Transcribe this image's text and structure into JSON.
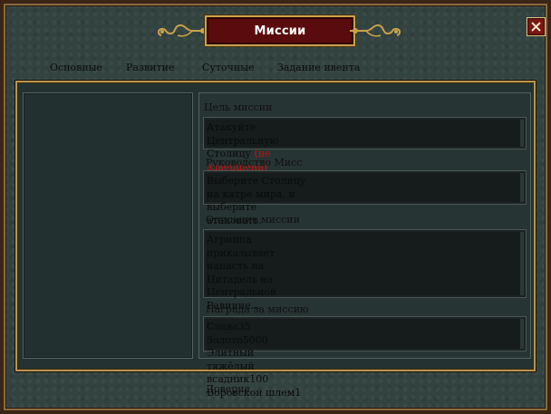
{
  "window": {
    "title": "Миссии",
    "close_label": "close"
  },
  "tabs": [
    {
      "label": "Основные"
    },
    {
      "label": "Развитие"
    },
    {
      "label": "Суточные"
    },
    {
      "label": "Задание ивента"
    }
  ],
  "mission": {
    "goal_label": "Цель миссии",
    "goal_text": "Атакуйте Центральную Столицу",
    "goal_status": "(не завершена)",
    "guide_label": "Руководство Мисс",
    "guide_text": "Выберите Столицу на катре мира, и выберите атаковать.",
    "description_label": "Описание миссии",
    "description_text": "Агриппа приказывает напасть на Цитадель на Центральной Равнине...",
    "reward_label": "Награда за миссию",
    "rewards": [
      {
        "text": "Слава35"
      },
      {
        "text": "Золото5000"
      },
      {
        "text": "Элитный тяжёлый всадник100"
      },
      {
        "text": "Воровской шлем1"
      }
    ],
    "overflow_text": "Доверие"
  },
  "colors": {
    "accent_gold": "#c9a24a",
    "title_bg": "#5a0b0d",
    "status_red": "#c81010"
  }
}
